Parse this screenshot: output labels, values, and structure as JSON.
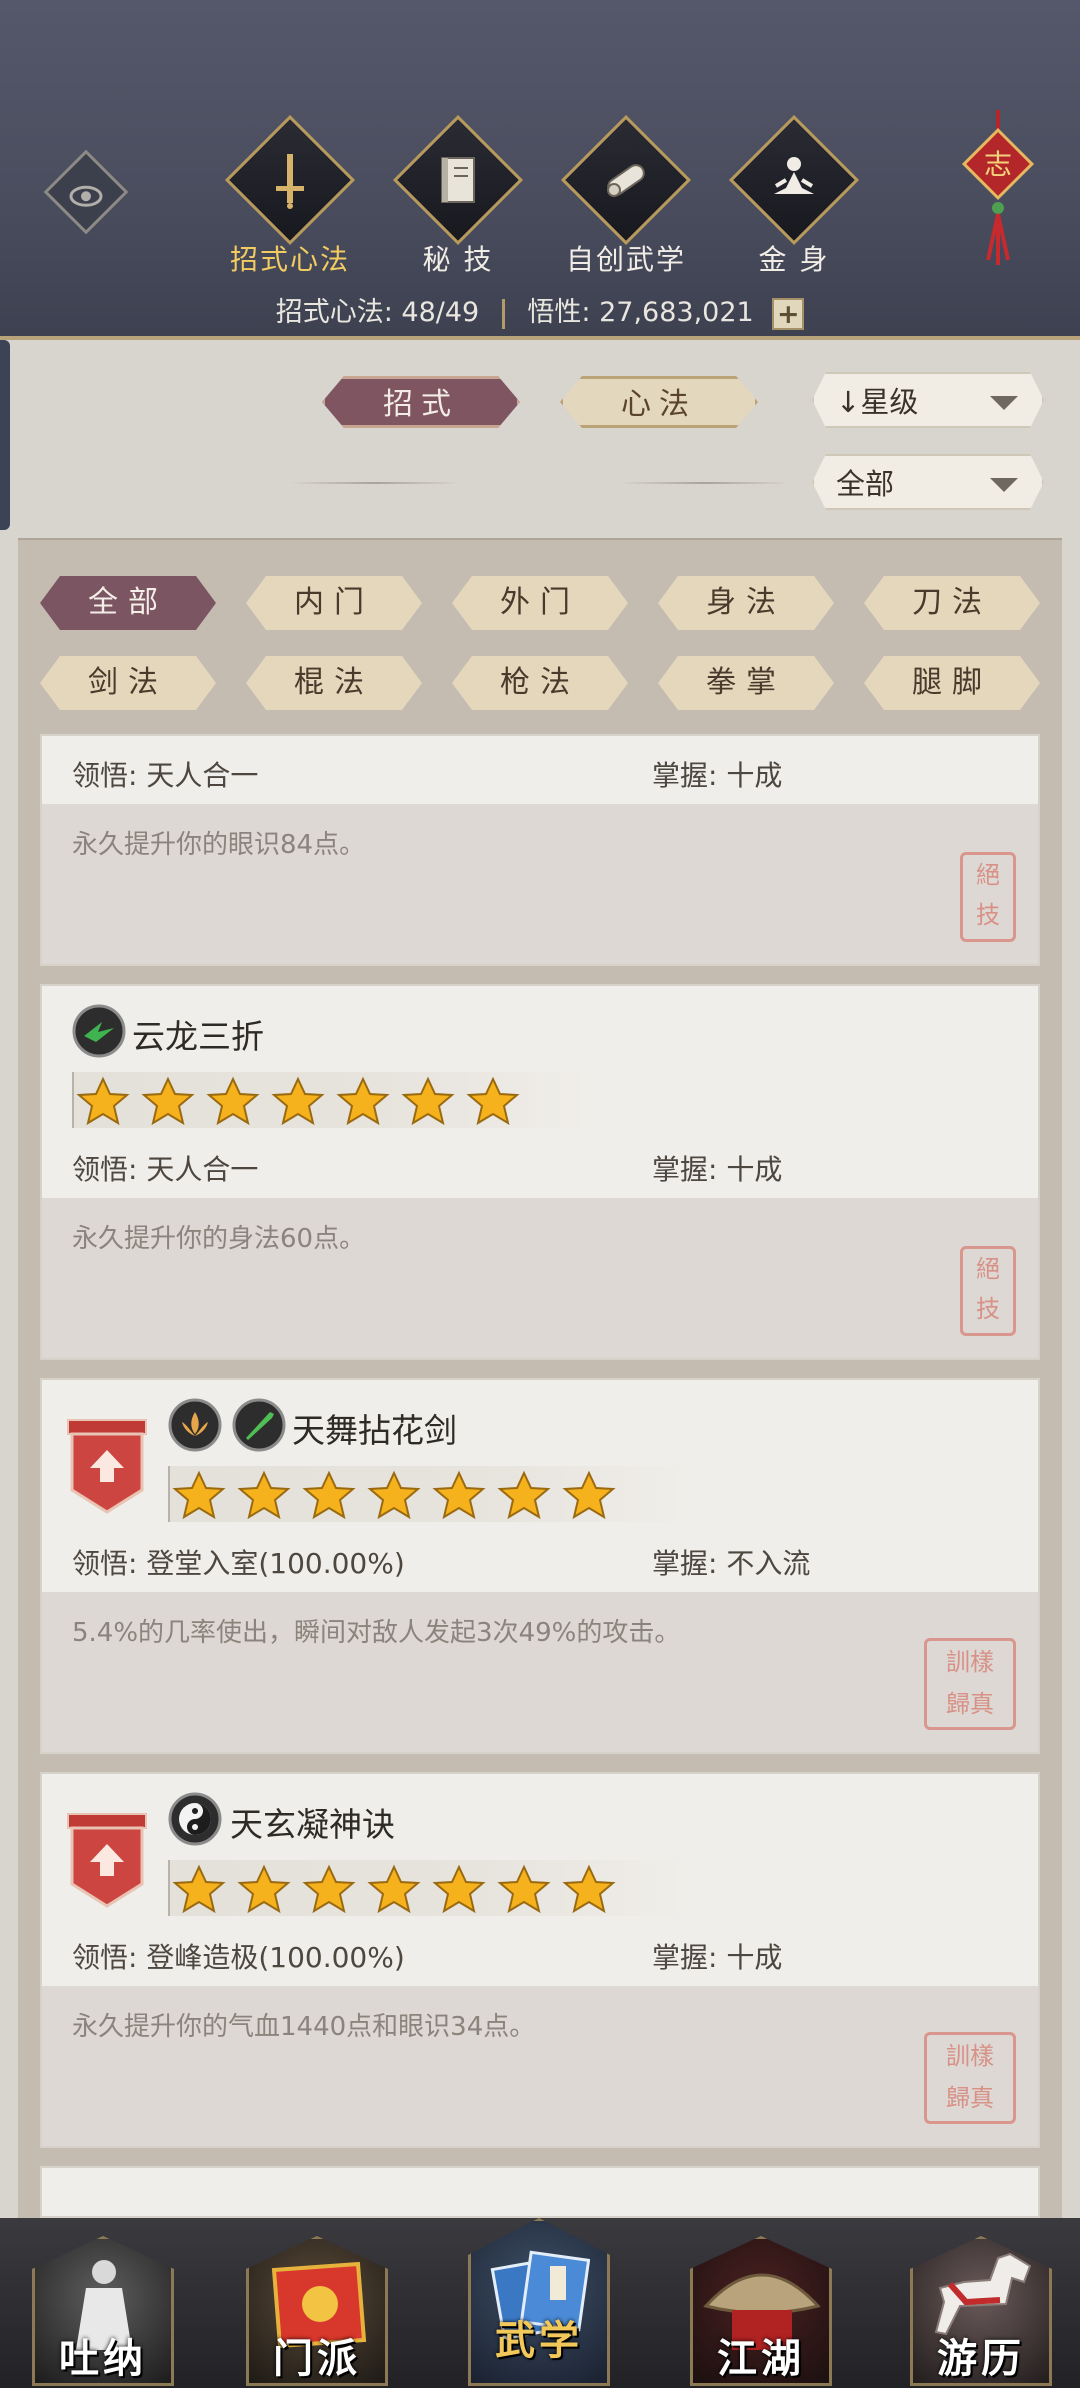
{
  "header": {
    "tabs": [
      {
        "label": "招式心法",
        "icon": "sword-icon"
      },
      {
        "label": "秘  技",
        "icon": "book-icon"
      },
      {
        "label": "自创武学",
        "icon": "scroll-icon"
      },
      {
        "label": "金  身",
        "icon": "meditation-icon"
      }
    ],
    "knot_char": "志",
    "status": {
      "label1": "招式心法:",
      "value1": "48/49",
      "label2": "悟性:",
      "value2": "27,683,021",
      "plus": "+"
    }
  },
  "filters": {
    "type_tabs": [
      "招式",
      "心法"
    ],
    "sort": "星级",
    "sort_arrow": "↓",
    "scope": "全部"
  },
  "categories": [
    "全部",
    "内门",
    "外门",
    "身法",
    "刀法",
    "剑法",
    "棍法",
    "枪法",
    "拳掌",
    "腿脚"
  ],
  "cards": [
    {
      "lingwu_label": "领悟:",
      "lingwu": "天人合一",
      "zhangwo_label": "掌握:",
      "zhangwo": "十成",
      "desc": "永久提升你的眼识84点。",
      "seal": [
        "絕",
        "技"
      ]
    },
    {
      "name": "云龙三折",
      "stars": 7,
      "lingwu_label": "领悟:",
      "lingwu": "天人合一",
      "zhangwo_label": "掌握:",
      "zhangwo": "十成",
      "desc": "永久提升你的身法60点。",
      "seal": [
        "絕",
        "技"
      ]
    },
    {
      "name": "天舞拈花剑",
      "stars": 7,
      "lingwu_label": "领悟:",
      "lingwu": "登堂入室(100.00%)",
      "zhangwo_label": "掌握:",
      "zhangwo": "不入流",
      "desc": "5.4%的几率使出，瞬间对敌人发起3次49%的攻击。",
      "seal": [
        "訓",
        "樣",
        "歸",
        "真"
      ]
    },
    {
      "name": "天玄凝神诀",
      "stars": 7,
      "lingwu_label": "领悟:",
      "lingwu": "登峰造极(100.00%)",
      "zhangwo_label": "掌握:",
      "zhangwo": "十成",
      "desc": "永久提升你的气血1440点和眼识34点。",
      "seal": [
        "訓",
        "樣",
        "歸",
        "真"
      ]
    }
  ],
  "bottom_nav": [
    "吐纳",
    "门派",
    "武学",
    "江湖",
    "游历"
  ],
  "colors": {
    "header_bg": "#4a4e5f",
    "active_gold": "#f3cc61",
    "active_pill": "#7e5560",
    "star": "#f5b21c"
  }
}
